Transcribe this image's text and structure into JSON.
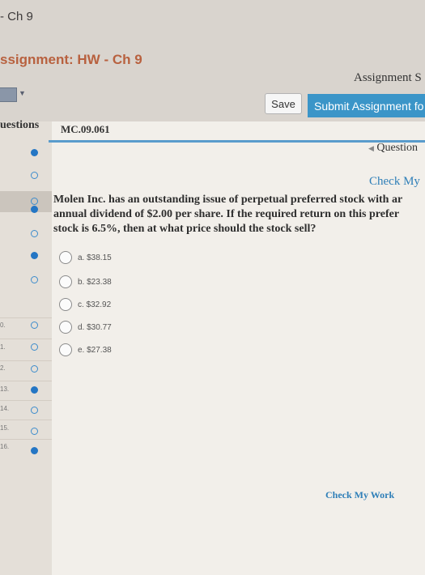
{
  "tab_title": "- Ch 9",
  "heading": "ssignment: HW - Ch 9",
  "assignment_score": "Assignment S",
  "toolbar": {
    "save_label": "Save",
    "submit_label": "Submit Assignment fo"
  },
  "sidebar": {
    "header": "uestions",
    "rows": [
      {
        "num": "",
        "status": "answered"
      },
      {
        "num": "",
        "status": "unanswered"
      },
      {
        "num": "",
        "status": "unanswered"
      },
      {
        "num": "",
        "status": "answered"
      },
      {
        "num": "",
        "status": "unanswered"
      },
      {
        "num": "",
        "status": "answered"
      },
      {
        "num": "",
        "status": "unanswered"
      },
      {
        "num": "0.",
        "status": "unanswered"
      },
      {
        "num": "1.",
        "status": "unanswered"
      },
      {
        "num": "2.",
        "status": "unanswered"
      },
      {
        "num": "13.",
        "status": "answered"
      },
      {
        "num": "14.",
        "status": "unanswered"
      },
      {
        "num": "15.",
        "status": "unanswered"
      },
      {
        "num": "16.",
        "status": "answered"
      }
    ]
  },
  "question": {
    "code": "MC.09.061",
    "nav_label": "Question",
    "check_label": "Check My",
    "text_lines": [
      "Molen Inc. has an outstanding issue of perpetual preferred stock with ar",
      "annual dividend of $2.00 per share. If the required return on this prefer",
      "stock is 6.5%, then at what price should the stock sell?"
    ],
    "choices": [
      "a. $38.15",
      "b. $23.38",
      "c. $32.92",
      "d. $30.77",
      "e. $27.38"
    ]
  },
  "footer": {
    "check_my_work": "Check My Work"
  },
  "colors": {
    "accent": "#3b95c8",
    "heading": "#b8613f",
    "link": "#2f7fb8",
    "dot": "#2476c4"
  }
}
